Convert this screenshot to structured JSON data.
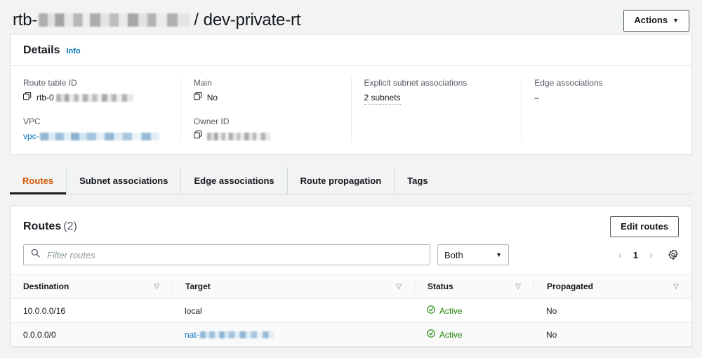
{
  "header": {
    "title_prefix": "rtb-",
    "title_separator": "/",
    "title_name": "dev-private-rt",
    "actions_label": "Actions",
    "caret": "▼"
  },
  "details": {
    "heading": "Details",
    "info_label": "Info",
    "fields": {
      "route_table_id": {
        "label": "Route table ID",
        "value_prefix": "rtb-0",
        "icon": "copy-icon"
      },
      "vpc": {
        "label": "VPC",
        "value_prefix": "vpc-",
        "is_link": "true"
      },
      "main": {
        "label": "Main",
        "value": "No",
        "icon": "copy-icon"
      },
      "owner_id": {
        "label": "Owner ID",
        "value": "",
        "icon": "copy-icon"
      },
      "explicit_subnet_associations": {
        "label": "Explicit subnet associations",
        "value": "2 subnets"
      },
      "edge_associations": {
        "label": "Edge associations",
        "value": "–"
      }
    }
  },
  "tabs": [
    {
      "label": "Routes",
      "active": true
    },
    {
      "label": "Subnet associations",
      "active": false
    },
    {
      "label": "Edge associations",
      "active": false
    },
    {
      "label": "Route propagation",
      "active": false
    },
    {
      "label": "Tags",
      "active": false
    }
  ],
  "routes_panel": {
    "title": "Routes",
    "count": "(2)",
    "edit_button": "Edit routes",
    "search_placeholder": "Filter routes",
    "filter_select_value": "Both",
    "pagination": {
      "prev": "‹",
      "page": "1",
      "next": "›"
    },
    "columns": [
      {
        "label": "Destination",
        "sort_icon": "sort-triangle-icon"
      },
      {
        "label": "Target",
        "sort_icon": "sort-triangle-icon"
      },
      {
        "label": "Status",
        "sort_icon": "sort-triangle-icon"
      },
      {
        "label": "Propagated",
        "sort_icon": "sort-triangle-icon"
      }
    ],
    "rows": [
      {
        "destination": "10.0.0.0/16",
        "target": "local",
        "target_is_link": false,
        "status": "Active",
        "status_icon": "status-success-icon",
        "propagated": "No"
      },
      {
        "destination": "0.0.0.0/0",
        "target": "nat-",
        "target_is_link": true,
        "status": "Active",
        "status_icon": "status-success-icon",
        "propagated": "No"
      }
    ]
  },
  "colors": {
    "accent_orange": "#d45b07",
    "link_blue": "#0073bb",
    "status_green": "#1d8102",
    "page_background": "#f2f3f3",
    "panel_border": "#d5dbdb"
  }
}
